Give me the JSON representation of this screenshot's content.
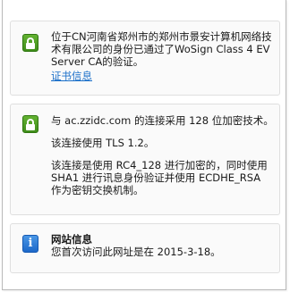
{
  "identity": {
    "icon": "lock-icon",
    "text": "位于CN河南省郑州市的郑州市景安计算机网络技术有限公司的身份已通过了WoSign Class 4 EV Server CA的验证。",
    "link": "证书信息"
  },
  "connection": {
    "icon": "lock-icon",
    "line1": "与 ac.zzidc.com 的连接采用 128 位加密技术。",
    "line2": "该连接使用 TLS 1.2。",
    "line3": "该连接是使用 RC4_128 进行加密的，同时使用 SHA1 进行讯息身份验证并使用 ECDHE_RSA 作为密钥交换机制。"
  },
  "site_info": {
    "icon": "info-icon",
    "title": "网站信息",
    "text": "您首次访问此网址是在 2015-3-18。"
  },
  "colors": {
    "lock_green": "#4a9e22",
    "info_blue": "#2b78d6",
    "link_blue": "#1a6fc9"
  }
}
